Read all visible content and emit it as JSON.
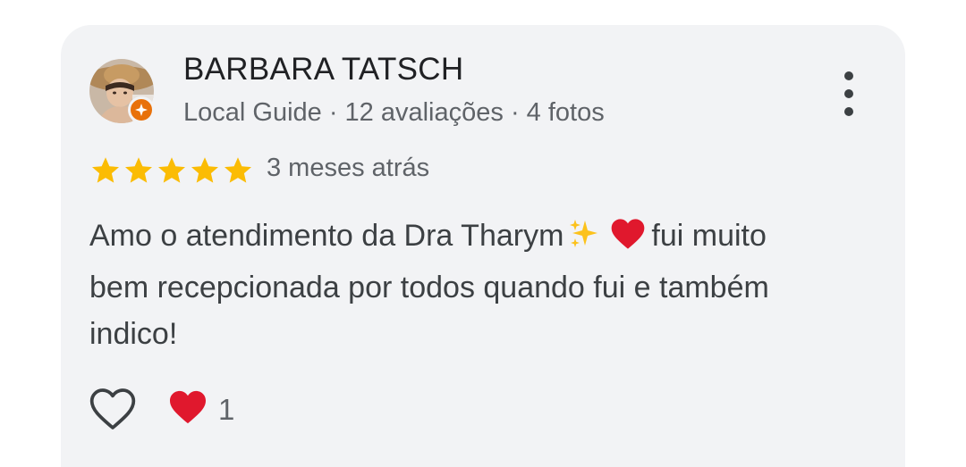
{
  "review": {
    "author_name": "BARBARA TATSCH",
    "author_meta": "Local Guide · 12 avaliações · 4 fotos",
    "rating": 5,
    "rating_max": 5,
    "time_ago": "3 meses atrás",
    "text_line1_a": "Amo o atendimento da Dra Tharym",
    "text_line1_b": "fui muito",
    "text_line2": "bem recepcionada por todos quando fui e também",
    "text_line3": "indico!",
    "reaction_count": "1"
  },
  "icons": {
    "avatar": "profile-photo",
    "badge": "local-guide-badge-icon",
    "menu": "more-vert-icon",
    "star": "star-icon",
    "emoji1": "sparkles-emoji",
    "emoji2": "red-heart-emoji",
    "like": "heart-outline-icon",
    "reaction": "red-heart-icon"
  },
  "colors": {
    "card_bg": "#f2f3f5",
    "star": "#fbbc04",
    "badge": "#e8710a",
    "heart": "#e0182d",
    "text_primary": "#202124",
    "text_secondary": "#5f6368"
  }
}
